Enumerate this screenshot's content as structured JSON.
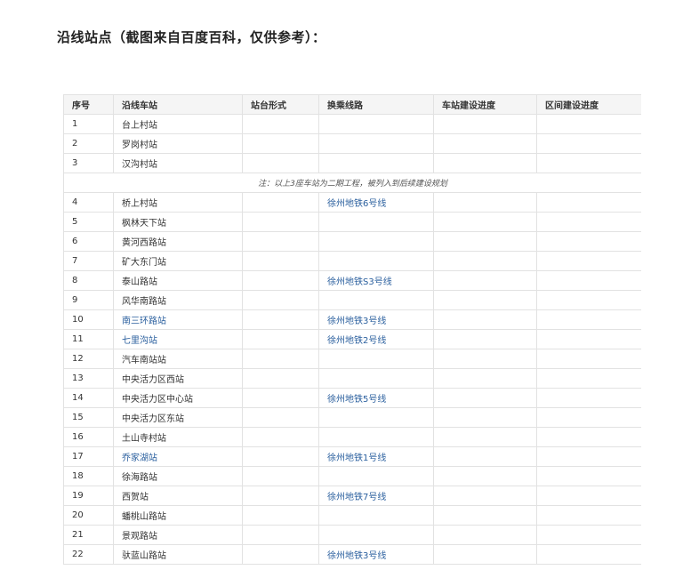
{
  "heading": "沿线站点（截图来自百度百科，仅供参考）：",
  "table": {
    "headers": [
      "序号",
      "沿线车站",
      "站台形式",
      "换乘线路",
      "车站建设进度",
      "区间建设进度"
    ],
    "rows_a": [
      {
        "no": "1",
        "station": "台上村站",
        "platform": "",
        "transfer": "",
        "station_progress": "",
        "section_progress": "",
        "station_link": false
      },
      {
        "no": "2",
        "station": "罗岗村站",
        "platform": "",
        "transfer": "",
        "station_progress": "",
        "section_progress": "",
        "station_link": false
      },
      {
        "no": "3",
        "station": "汉沟村站",
        "platform": "",
        "transfer": "",
        "station_progress": "",
        "section_progress": "",
        "station_link": false
      }
    ],
    "note": "注：以上3座车站为二期工程，被列入到后续建设规划",
    "rows_b": [
      {
        "no": "4",
        "station": "桥上村站",
        "platform": "",
        "transfer": "徐州地铁6号线",
        "station_progress": "",
        "section_progress": "",
        "station_link": false
      },
      {
        "no": "5",
        "station": "枫林天下站",
        "platform": "",
        "transfer": "",
        "station_progress": "",
        "section_progress": "",
        "station_link": false
      },
      {
        "no": "6",
        "station": "黄河西路站",
        "platform": "",
        "transfer": "",
        "station_progress": "",
        "section_progress": "",
        "station_link": false
      },
      {
        "no": "7",
        "station": "矿大东门站",
        "platform": "",
        "transfer": "",
        "station_progress": "",
        "section_progress": "",
        "station_link": false
      },
      {
        "no": "8",
        "station": "泰山路站",
        "platform": "",
        "transfer": "徐州地铁S3号线",
        "station_progress": "",
        "section_progress": "",
        "station_link": false
      },
      {
        "no": "9",
        "station": "风华南路站",
        "platform": "",
        "transfer": "",
        "station_progress": "",
        "section_progress": "",
        "station_link": false
      },
      {
        "no": "10",
        "station": "南三环路站",
        "platform": "",
        "transfer": "徐州地铁3号线",
        "station_progress": "",
        "section_progress": "",
        "station_link": true
      },
      {
        "no": "11",
        "station": "七里沟站",
        "platform": "",
        "transfer": "徐州地铁2号线",
        "station_progress": "",
        "section_progress": "",
        "station_link": true
      },
      {
        "no": "12",
        "station": "汽车南站站",
        "platform": "",
        "transfer": "",
        "station_progress": "",
        "section_progress": "",
        "station_link": false
      },
      {
        "no": "13",
        "station": "中央活力区西站",
        "platform": "",
        "transfer": "",
        "station_progress": "",
        "section_progress": "",
        "station_link": false
      },
      {
        "no": "14",
        "station": "中央活力区中心站",
        "platform": "",
        "transfer": "徐州地铁5号线",
        "station_progress": "",
        "section_progress": "",
        "station_link": false
      },
      {
        "no": "15",
        "station": "中央活力区东站",
        "platform": "",
        "transfer": "",
        "station_progress": "",
        "section_progress": "",
        "station_link": false
      },
      {
        "no": "16",
        "station": "土山寺村站",
        "platform": "",
        "transfer": "",
        "station_progress": "",
        "section_progress": "",
        "station_link": false
      },
      {
        "no": "17",
        "station": "乔家湖站",
        "platform": "",
        "transfer": "徐州地铁1号线",
        "station_progress": "",
        "section_progress": "",
        "station_link": true
      },
      {
        "no": "18",
        "station": "徐海路站",
        "platform": "",
        "transfer": "",
        "station_progress": "",
        "section_progress": "",
        "station_link": false
      },
      {
        "no": "19",
        "station": "西贺站",
        "platform": "",
        "transfer": "徐州地铁7号线",
        "station_progress": "",
        "section_progress": "",
        "station_link": false
      },
      {
        "no": "20",
        "station": "蟠桃山路站",
        "platform": "",
        "transfer": "",
        "station_progress": "",
        "section_progress": "",
        "station_link": false
      },
      {
        "no": "21",
        "station": "景观路站",
        "platform": "",
        "transfer": "",
        "station_progress": "",
        "section_progress": "",
        "station_link": false
      },
      {
        "no": "22",
        "station": "驮蓝山路站",
        "platform": "",
        "transfer": "徐州地铁3号线",
        "station_progress": "",
        "section_progress": "",
        "station_link": false
      }
    ]
  },
  "colors": {
    "link": "#2a5f9e",
    "border": "#e2e2e2",
    "header_bg": "#f5f5f5"
  }
}
